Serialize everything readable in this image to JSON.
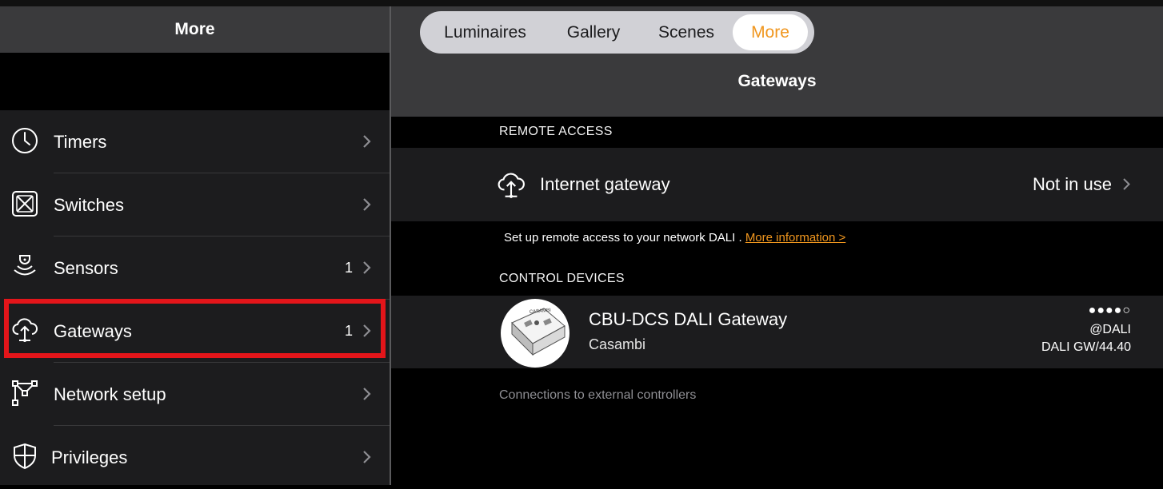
{
  "sidebar": {
    "title": "More",
    "items": [
      {
        "label": "Timers",
        "count": "",
        "icon": "clock-icon"
      },
      {
        "label": "Switches",
        "count": "",
        "icon": "switch-icon"
      },
      {
        "label": "Sensors",
        "count": "1",
        "icon": "sensor-icon"
      },
      {
        "label": "Gateways",
        "count": "1",
        "icon": "cloud-gateway-icon"
      },
      {
        "label": "Network setup",
        "count": "",
        "icon": "network-icon"
      },
      {
        "label": "Privileges",
        "count": "",
        "icon": "shield-icon"
      }
    ],
    "highlight_color": "#e3151a"
  },
  "tabs": [
    {
      "label": "Luminaires",
      "active": false
    },
    {
      "label": "Gallery",
      "active": false
    },
    {
      "label": "Scenes",
      "active": false
    },
    {
      "label": "More",
      "active": true
    }
  ],
  "main": {
    "title": "Gateways",
    "remote_access": {
      "section_label": "REMOTE ACCESS",
      "item_label": "Internet gateway",
      "item_value": "Not in use",
      "note": "Set up remote access to your network DALI .",
      "note_link": "More information >"
    },
    "control_devices": {
      "section_label": "CONTROL DEVICES",
      "device": {
        "name": "CBU-DCS DALI Gateway",
        "brand": "Casambi",
        "signal": "●●●●○",
        "tag": "@DALI",
        "version": "DALI GW/44.40",
        "image_text": "CASAMBI"
      }
    },
    "footer_note": "Connections to external controllers"
  },
  "colors": {
    "accent": "#f0961e",
    "header_bg": "#3a3a3c",
    "list_bg": "#1c1c1e"
  }
}
